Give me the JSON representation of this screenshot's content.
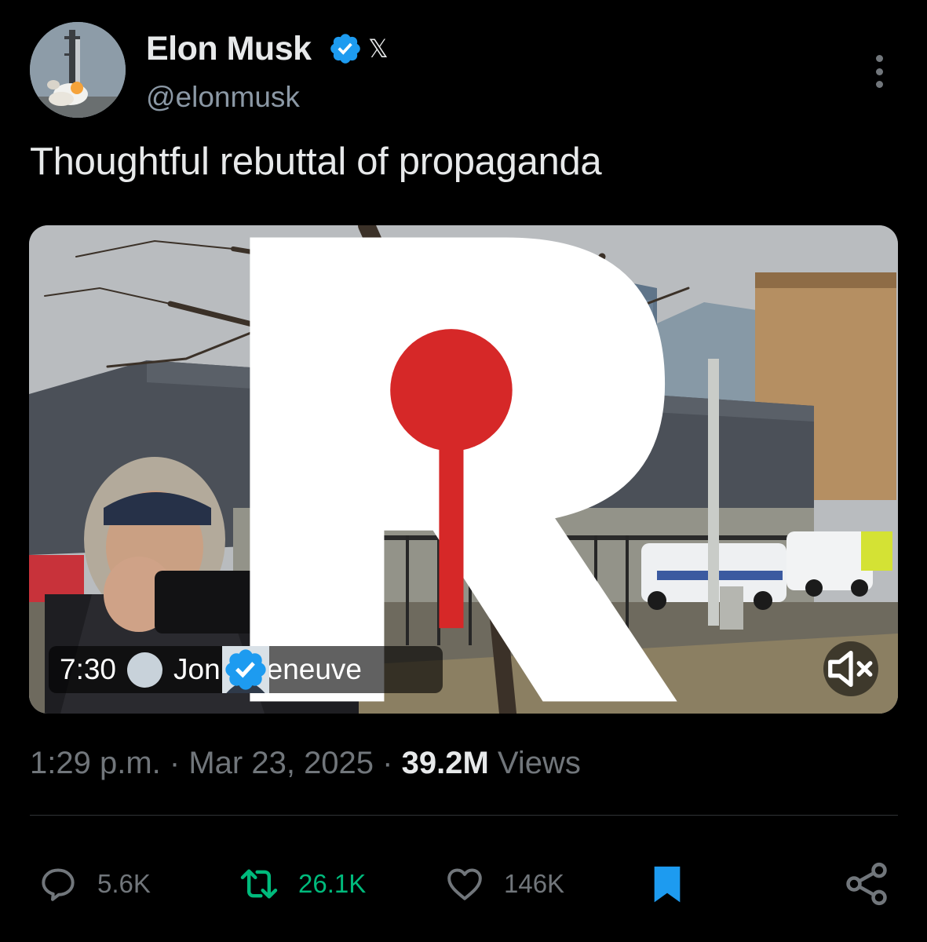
{
  "author": {
    "display_name": "Elon Musk",
    "handle": "@elonmusk",
    "verified": true,
    "affiliate_badge": "𝕏"
  },
  "tweet": {
    "text": "Thoughtful rebuttal of propaganda",
    "time": "1:29 p.m.",
    "separator": "·",
    "date": "Mar 23, 2025",
    "views_count": "39.2M",
    "views_label": "Views"
  },
  "media": {
    "duration": "7:30",
    "channel_name": "Jon Villeneuve",
    "channel_verified": true,
    "watermark": "R"
  },
  "actions": {
    "replies": "5.6K",
    "reposts": "26.1K",
    "likes": "146K"
  },
  "colors": {
    "background": "#000000",
    "text_primary": "#e7e9ea",
    "text_secondary": "#71767b",
    "verified_blue": "#1d9bf0",
    "repost_green": "#00ba7c",
    "bookmark_blue": "#1d9bf0"
  },
  "icons": [
    "more-icon",
    "verified-icon",
    "mute-icon",
    "reply-icon",
    "repost-icon",
    "like-icon",
    "bookmark-icon",
    "share-icon"
  ]
}
